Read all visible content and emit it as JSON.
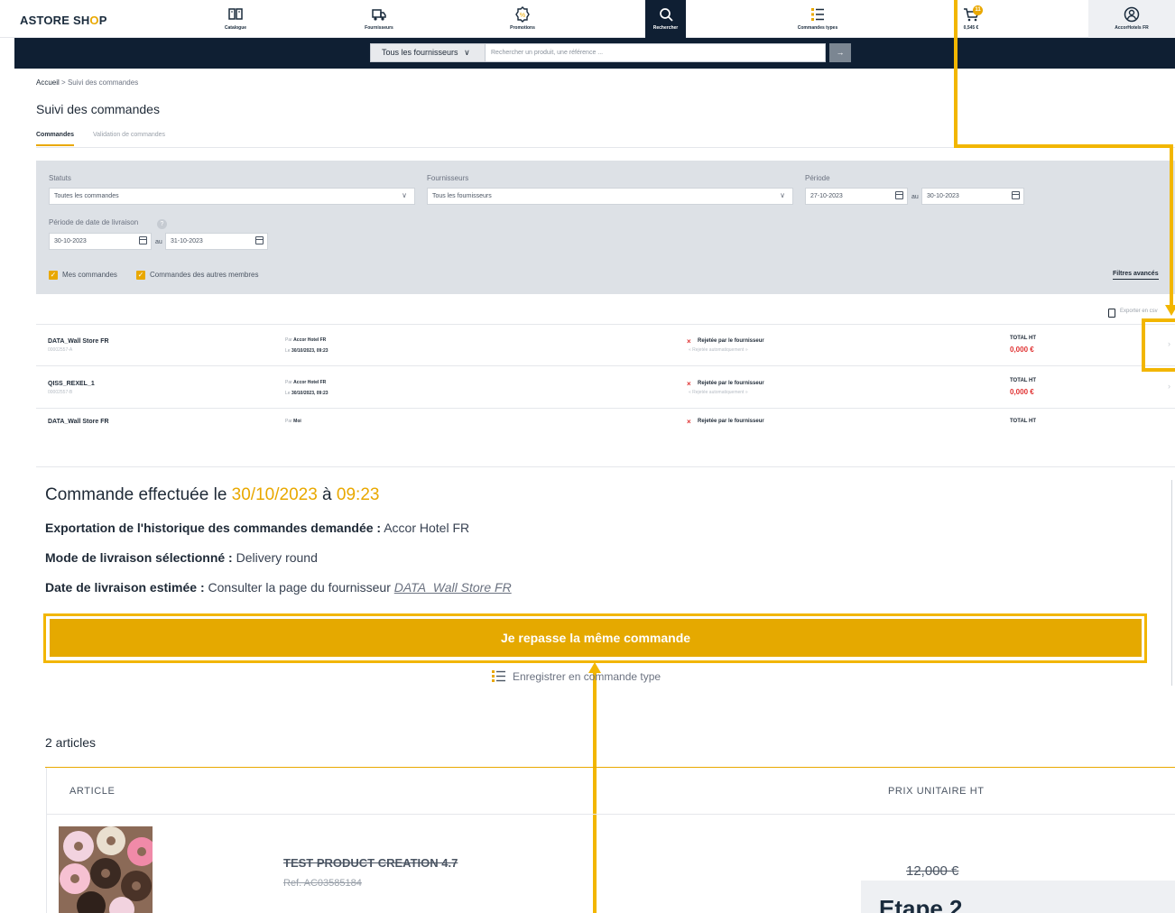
{
  "header": {
    "logo": "ASTORE SHOP",
    "nav": [
      {
        "label": "Catalogue",
        "icon": "book-icon"
      },
      {
        "label": "Fournisseurs",
        "icon": "truck-icon"
      },
      {
        "label": "Promotions",
        "icon": "promo-badge-icon"
      },
      {
        "label": "Rechercher",
        "icon": "search-icon"
      },
      {
        "label": "Commandes types",
        "icon": "list-icon"
      },
      {
        "label": "0,545 €",
        "icon": "cart-icon",
        "badge": "11"
      },
      {
        "label": "AccorHotels FR",
        "icon": "user-icon"
      }
    ]
  },
  "search": {
    "supplier_select": "Tous les fournisseurs",
    "placeholder": "Rechercher un produit, une référence ...",
    "go_label": "→"
  },
  "breadcrumb": {
    "home": "Accueil",
    "separator": ">",
    "current": "Suivi des commandes"
  },
  "page_title": "Suivi des commandes",
  "tabs": [
    "Commandes",
    "Validation de commandes"
  ],
  "filters": {
    "status_label": "Statuts",
    "status_value": "Toutes les commandes",
    "suppliers_label": "Fournisseurs",
    "suppliers_value": "Tous les fournisseurs",
    "period_label": "Période",
    "period_from": "27-10-2023",
    "period_to": "30-10-2023",
    "au": "au",
    "delivery_period_label": "Période de date de livraison",
    "delivery_from": "30-10-2023",
    "delivery_to": "31-10-2023",
    "my_orders": "Mes commandes",
    "others_orders": "Commandes des autres membres",
    "advanced": "Filtres avancés"
  },
  "export_label": "Exporter en csv",
  "orders": [
    {
      "supplier": "DATA_Wall Store FR",
      "number": "00002557-A",
      "by_prefix": "Par",
      "by": "Accor Hotel FR",
      "date_prefix": "Le",
      "date": "30/10/2023, 09:23",
      "status": "Rejetée par le fournisseur",
      "status_sub": "« Rejetée automatiquement »",
      "total_label": "TOTAL HT",
      "total": "0,000 €"
    },
    {
      "supplier": "QISS_REXEL_1",
      "number": "00002557-B",
      "by_prefix": "Par",
      "by": "Accor Hotel FR",
      "date_prefix": "Le",
      "date": "30/10/2023, 09:23",
      "status": "Rejetée par le fournisseur",
      "status_sub": "« Rejetée automatiquement »",
      "total_label": "TOTAL HT",
      "total": "0,000 €"
    },
    {
      "supplier": "DATA_Wall Store FR",
      "number": "",
      "by_prefix": "Par",
      "by": "Moi",
      "date_prefix": "",
      "date": "",
      "status": "Rejetée par le fournisseur",
      "status_sub": "",
      "total_label": "TOTAL HT",
      "total": ""
    }
  ],
  "detail": {
    "title_prefix": "Commande effectuée le",
    "title_date": "30/10/2023",
    "title_mid": "à",
    "title_time": "09:23",
    "export_label": "Exportation de l'historique des commandes demandée :",
    "export_value": "Accor Hotel FR",
    "delivery_mode_label": "Mode de livraison sélectionné :",
    "delivery_mode_value": "Delivery round",
    "delivery_date_label": "Date de livraison estimée :",
    "delivery_date_value": "Consulter la page du fournisseur",
    "delivery_date_link": "DATA_Wall Store FR",
    "reorder_button": "Je repasse la même commande",
    "save_template": "Enregistrer en commande type"
  },
  "articles": {
    "count_label": "2 articles",
    "col_article": "ARTICLE",
    "col_price": "PRIX UNITAIRE HT",
    "items": [
      {
        "name": "TEST PRODUCT CREATION 4.7",
        "ref": "Ref. AC03585184",
        "price": "12,000 €"
      }
    ]
  },
  "step_label": "Etape 2",
  "colors": {
    "accent": "#e9a800",
    "navy": "#0f1f33",
    "annotation": "#f2b600",
    "reject": "#e03131"
  }
}
